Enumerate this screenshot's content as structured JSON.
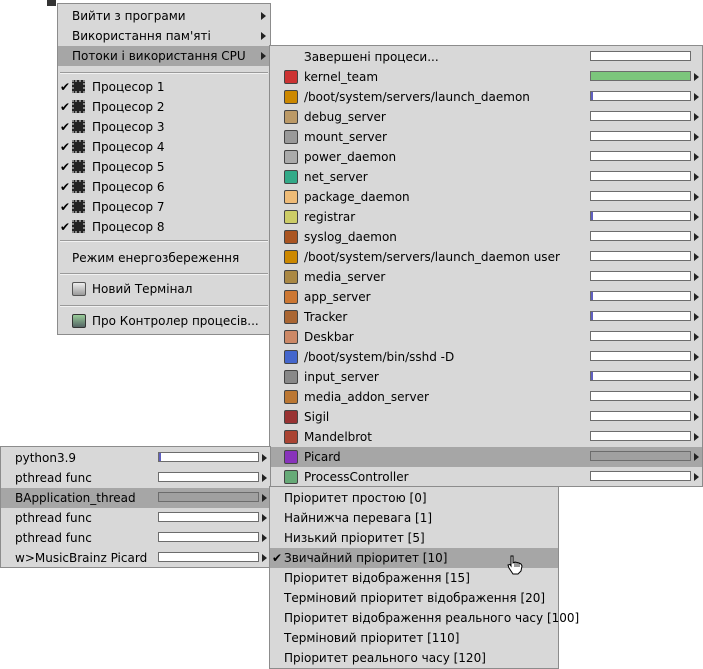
{
  "main_menu": {
    "items": [
      {
        "label": "Вийти з програми",
        "submenu": true
      },
      {
        "label": "Використання пам'яті",
        "submenu": true
      },
      {
        "label": "Потоки і використання CPU",
        "submenu": true,
        "highlighted": true
      }
    ],
    "processors": [
      {
        "label": "Процесор 1",
        "checked": true
      },
      {
        "label": "Процесор 2",
        "checked": true
      },
      {
        "label": "Процесор 3",
        "checked": true
      },
      {
        "label": "Процесор 4",
        "checked": true
      },
      {
        "label": "Процесор 5",
        "checked": true
      },
      {
        "label": "Процесор 6",
        "checked": true
      },
      {
        "label": "Процесор 7",
        "checked": true
      },
      {
        "label": "Процесор 8",
        "checked": true
      }
    ],
    "power_saving": "Режим енергозбереження",
    "new_terminal": "Новий Термінал",
    "about": "Про Контролер процесів...",
    "check_mark": "✔"
  },
  "team_menu": {
    "items": [
      {
        "label": "Завершені процеси...",
        "icon": "none",
        "submenu": false,
        "usage": 0
      },
      {
        "label": "kernel_team",
        "icon": "kernel-icon",
        "submenu": true,
        "usage": 1.0,
        "fill": "#7cc67c"
      },
      {
        "label": "/boot/system/servers/launch_daemon",
        "icon": "launch-daemon-icon",
        "submenu": true,
        "usage": 0.01,
        "fill": "#6060c0"
      },
      {
        "label": "debug_server",
        "icon": "debug-server-icon",
        "submenu": true,
        "usage": 0
      },
      {
        "label": "mount_server",
        "icon": "mount-server-icon",
        "submenu": true,
        "usage": 0
      },
      {
        "label": "power_daemon",
        "icon": "power-daemon-icon",
        "submenu": true,
        "usage": 0
      },
      {
        "label": "net_server",
        "icon": "net-server-icon",
        "submenu": true,
        "usage": 0
      },
      {
        "label": "package_daemon",
        "icon": "package-daemon-icon",
        "submenu": true,
        "usage": 0
      },
      {
        "label": "registrar",
        "icon": "registrar-icon",
        "submenu": true,
        "usage": 0.01,
        "fill": "#6060c0"
      },
      {
        "label": "syslog_daemon",
        "icon": "syslog-daemon-icon",
        "submenu": true,
        "usage": 0
      },
      {
        "label": "/boot/system/servers/launch_daemon user",
        "icon": "launch-daemon-user-icon",
        "submenu": true,
        "usage": 0
      },
      {
        "label": "media_server",
        "icon": "media-server-icon",
        "submenu": true,
        "usage": 0
      },
      {
        "label": "app_server",
        "icon": "app-server-icon",
        "submenu": true,
        "usage": 0.01,
        "fill": "#6060c0"
      },
      {
        "label": "Tracker",
        "icon": "tracker-icon",
        "submenu": true,
        "usage": 0.01,
        "fill": "#6060c0"
      },
      {
        "label": "Deskbar",
        "icon": "deskbar-icon",
        "submenu": true,
        "usage": 0
      },
      {
        "label": "/boot/system/bin/sshd -D",
        "icon": "sshd-icon",
        "submenu": true,
        "usage": 0
      },
      {
        "label": "input_server",
        "icon": "input-server-icon",
        "submenu": true,
        "usage": 0.01,
        "fill": "#6060c0"
      },
      {
        "label": "media_addon_server",
        "icon": "media-addon-server-icon",
        "submenu": true,
        "usage": 0
      },
      {
        "label": "Sigil",
        "icon": "sigil-icon",
        "submenu": true,
        "usage": 0
      },
      {
        "label": "Mandelbrot",
        "icon": "mandelbrot-icon",
        "submenu": true,
        "usage": 0
      },
      {
        "label": "Picard",
        "icon": "picard-icon",
        "submenu": true,
        "usage": 0,
        "highlighted": true
      },
      {
        "label": "ProcessController",
        "icon": "processcontroller-icon",
        "submenu": true,
        "usage": 0
      }
    ]
  },
  "thread_menu": {
    "items": [
      {
        "label": "python3.9",
        "usage": 0.01
      },
      {
        "label": "pthread func",
        "usage": 0
      },
      {
        "label": "BApplication_thread",
        "usage": 0,
        "highlighted": true
      },
      {
        "label": "pthread func",
        "usage": 0
      },
      {
        "label": "pthread func",
        "usage": 0
      },
      {
        "label": "w>MusicBrainz Picard",
        "usage": 0
      }
    ]
  },
  "priority_menu": {
    "items": [
      {
        "label": "Пріоритет простою [0]"
      },
      {
        "label": "Найнижча перевага [1]"
      },
      {
        "label": "Низький пріоритет [5]"
      },
      {
        "label": "Звичайний пріоритет [10]",
        "checked": true,
        "highlighted": true
      },
      {
        "label": "Пріоритет відображення [15]"
      },
      {
        "label": "Терміновий пріоритет відображення [20]"
      },
      {
        "label": "Пріоритет відображення реального часу [100]"
      },
      {
        "label": "Терміновий пріоритет [110]"
      },
      {
        "label": "Пріоритет реального часу [120]"
      }
    ]
  },
  "colors": {
    "menu_bg": "#d8d8d8",
    "highlight_bg": "#a6a6a6",
    "usage_fill_kernel": "#7cc67c",
    "usage_fill_small": "#6060c0"
  }
}
